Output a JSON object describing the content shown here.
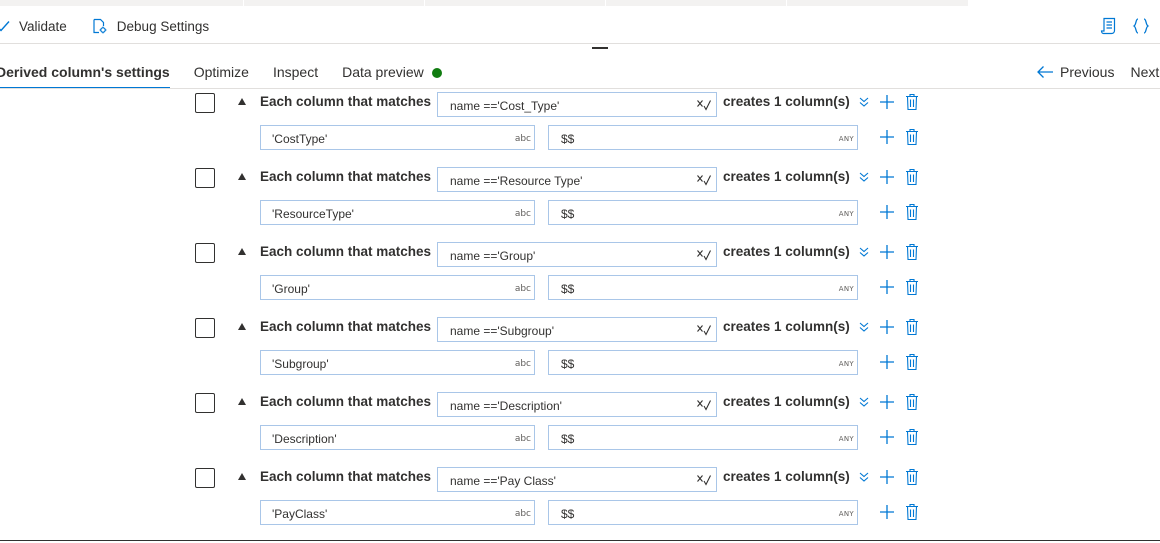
{
  "toolbar": {
    "validate_label": "Validate",
    "debug_label": "Debug Settings"
  },
  "tabs": [
    {
      "label": "Derived column's settings",
      "active": true
    },
    {
      "label": "Optimize",
      "active": false
    },
    {
      "label": "Inspect",
      "active": false
    },
    {
      "label": "Data preview",
      "active": false,
      "status": "green-dot"
    }
  ],
  "nav": {
    "previous_label": "Previous",
    "next_label": "Next"
  },
  "colors": {
    "accent": "#0078d4",
    "status_green": "#107c10",
    "input_border": "#a9c6e8"
  },
  "rule_labels": {
    "match_label": "Each column that matches",
    "creates_label": "creates 1 column(s)",
    "type_badge": "abc",
    "expr_type_badge": "ANY"
  },
  "rules": [
    {
      "condition": "name =='Cost_Type'",
      "column_name": "'CostType'",
      "expression": "$$"
    },
    {
      "condition": "name =='Resource Type'",
      "column_name": "'ResourceType'",
      "expression": "$$"
    },
    {
      "condition": "name =='Group'",
      "column_name": "'Group'",
      "expression": "$$"
    },
    {
      "condition": "name =='Subgroup'",
      "column_name": "'Subgroup'",
      "expression": "$$"
    },
    {
      "condition": "name =='Description'",
      "column_name": "'Description'",
      "expression": "$$"
    },
    {
      "condition": "name =='Pay Class'",
      "column_name": "'PayClass'",
      "expression": "$$"
    }
  ]
}
